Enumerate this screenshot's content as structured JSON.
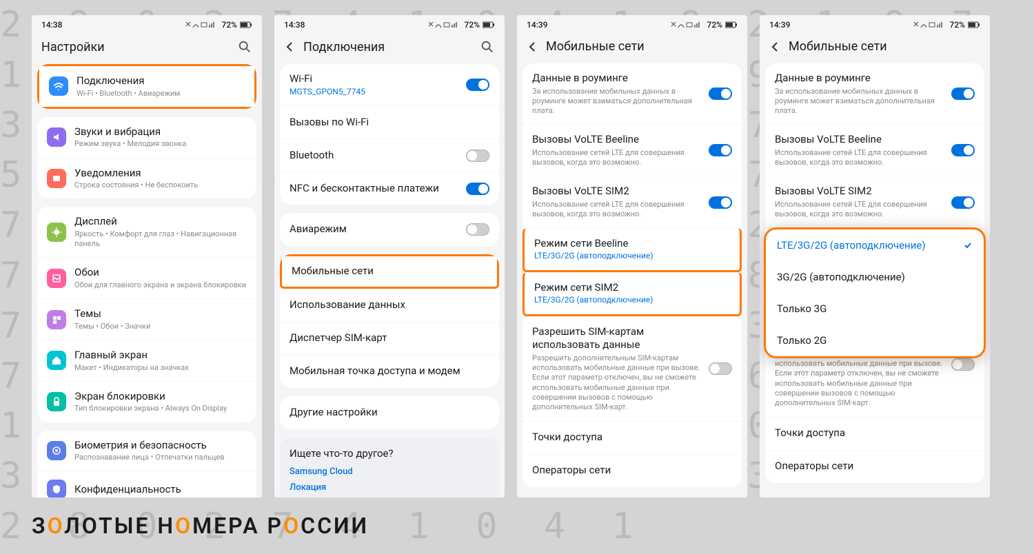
{
  "bg_numbers": "2 8 0 2 7 4 1 0 4 1 8 2 1 9 7 1 5 0 4 1 9 7 5 3 7 3 9 4 9 1 3 7 6 4 2 1 3 8 6 1 4 7 2 9 7 5 3 9 6 4 9 1 3 7 2 9 7 5 8 3 7 4 0 9 9 4 6 2 1 8 7 2 9 1 0 7 5 0 6 5 2 6 2 0 1 4 8 2 1 9 7 5 8 3 7 4 0 2 5 4 8 3 7 6 4 7 2 5 3 0 4 2 7 0 9 3 6 4 0 4 1 5 8 2 4 6 1 8 7 2 3 0 9 4 7 3 0 8 2 5 1 5 8 3 6 9 3 0 5 7 2 8 0 2 7 4 1 0 4 1",
  "status": {
    "time_a": "14:38",
    "time_b": "14:39",
    "battery": "72%"
  },
  "s1": {
    "title": "Настройки",
    "items": [
      {
        "title": "Подключения",
        "sub": "Wi-Fi  •  Bluetooth  •  Авиарежим",
        "color": "#2d8cff",
        "icon": "wifi"
      },
      {
        "title": "Звуки и вибрация",
        "sub": "Режим звука  •  Мелодия звонка",
        "color": "#8e6cf0",
        "icon": "sound"
      },
      {
        "title": "Уведомления",
        "sub": "Строка состояния  •  Не беспокоить",
        "color": "#ff6b5b",
        "icon": "notif"
      },
      {
        "title": "Дисплей",
        "sub": "Яркость  •  Комфорт для глаз  •  Навигационная панель",
        "color": "#8bc34a",
        "icon": "display"
      },
      {
        "title": "Обои",
        "sub": "Обои для главного экрана и экрана блокировки",
        "color": "#ff5f9e",
        "icon": "wallpaper"
      },
      {
        "title": "Темы",
        "sub": "Темы  •  Обои  •  Значки",
        "color": "#c07de8",
        "icon": "themes"
      },
      {
        "title": "Главный экран",
        "sub": "Макет  •  Индикаторы на значках",
        "color": "#00c4d4",
        "icon": "home"
      },
      {
        "title": "Экран блокировки",
        "sub": "Тип блокировки экрана  •  Always On Display",
        "color": "#00bfa5",
        "icon": "lock"
      },
      {
        "title": "Биометрия и безопасность",
        "sub": "Распознавание лица  •  Отпечатки пальцев",
        "color": "#5b7de8",
        "icon": "bio"
      },
      {
        "title": "Конфиденциальность",
        "sub": "",
        "color": "#6c7bf0",
        "icon": "privacy"
      }
    ]
  },
  "s2": {
    "title": "Подключения",
    "group1": [
      {
        "title": "Wi-Fi",
        "sub": "MGTS_GPON5_7745",
        "toggle": "on"
      },
      {
        "title": "Вызовы по Wi-Fi"
      },
      {
        "title": "Bluetooth",
        "toggle": "off"
      },
      {
        "title": "NFC и бесконтактные платежи",
        "toggle": "on"
      }
    ],
    "group2": [
      {
        "title": "Авиарежим",
        "toggle": "off"
      }
    ],
    "group3": [
      {
        "title": "Мобильные сети",
        "hl": true
      },
      {
        "title": "Использование данных"
      },
      {
        "title": "Диспетчер SIM-карт"
      },
      {
        "title": "Мобильная точка доступа и модем"
      }
    ],
    "group4": [
      {
        "title": "Другие настройки"
      }
    ],
    "looking": {
      "q": "Ищете что-то другое?",
      "l1": "Samsung Cloud",
      "l2": "Локация"
    }
  },
  "s3": {
    "title": "Мобильные сети",
    "roaming": {
      "t": "Данные в роуминге",
      "d": "За использование мобильных данных в роуминге может взиматься дополнительная плата."
    },
    "volte1": {
      "t": "Вызовы VoLTE Beeline",
      "d": "Использование сетей LTE для совершения вызовов, когда это возможно."
    },
    "volte2": {
      "t": "Вызовы VoLTE SIM2",
      "d": "Использование сетей LTE для совершения вызовов, когда это возможно."
    },
    "mode1": {
      "t": "Режим сети Beeline",
      "v": "LTE/3G/2G (автоподключение)"
    },
    "mode2": {
      "t": "Режим сети SIM2",
      "v": "LTE/3G/2G (автоподключение)"
    },
    "simdata": {
      "t": "Разрешить SIM-картам использовать данные",
      "d": "Разрешить дополнительным SIM-картам использовать мобильные данные при вызове. Если этот параметр отключен, вы не сможете использовать мобильные данные при совершении вызовов с помощью дополнительных SIM-карт."
    },
    "apn": "Точки доступа",
    "ops": "Операторы сети"
  },
  "s4": {
    "dropdown": {
      "opts": [
        "LTE/3G/2G (автоподключение)",
        "3G/2G (автоподключение)",
        "Только 3G",
        "Только 2G"
      ],
      "selected": 0
    }
  },
  "wordmark": {
    "z": "З",
    "o": "О",
    "rest1": "ЛОТЫЕ Н",
    "rest2": "МЕРА Р",
    "rest3": "ССИИ"
  }
}
